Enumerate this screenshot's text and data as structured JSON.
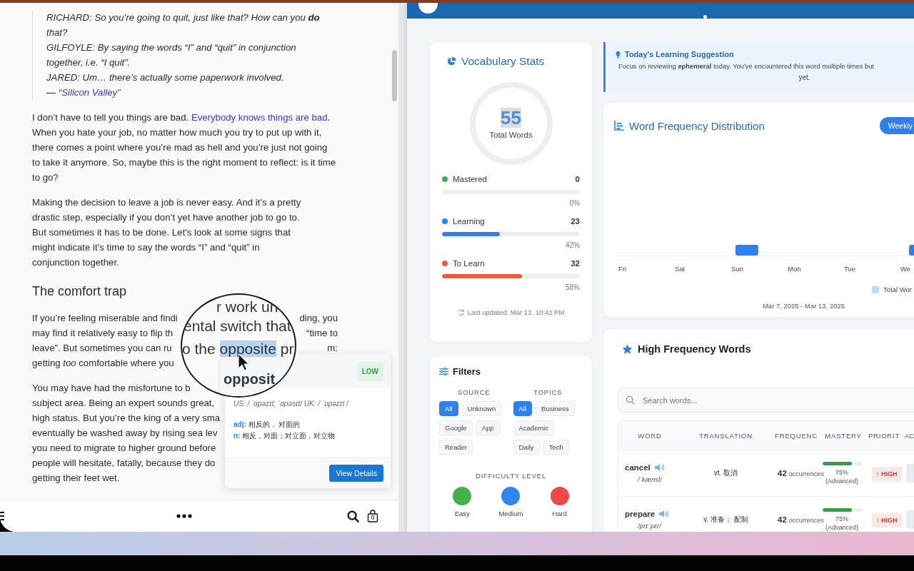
{
  "reader": {
    "quote_lines": [
      "RICHARD: So you’re going to quit, just like that? How can you **do** that?",
      "GILFOYLE: By saying the words “I” and “quit” in conjunction together, i.e. “I quit”.",
      "JARED: Um… there’s actually some paperwork involved."
    ],
    "quote_dash": "—",
    "quote_source": "“Silicon Valley”",
    "paragraph_1": {
      "before": "I don’t have to tell you things are bad. ",
      "link": "Everybody knows things are bad",
      "after": ". When you hate your job, no matter how much you try to put up with it, there comes a point where you’re mad as hell and you’re just not going to take it anymore. So, maybe this is the right moment to reflect: is it time to go?"
    },
    "paragraph_2": "Making the decision to leave a job is never easy. And it’s a pretty drastic step, especially if you don’t yet have another job to go to. But sometimes it has to be done. Let’s look at some signs that might indicate it’s time to say the words “I” and “quit” in conjunction together.",
    "heading": "The comfort trap",
    "cut_paragraphs": [
      {
        "lines": [
          {
            "left": "If you’re feeling miserable and findi",
            "right": "ding, you"
          },
          {
            "left": "may find it relatively easy to flip th",
            "right": "“time to"
          },
          {
            "left": "leave”. But sometimes you can ru",
            "right": "m:"
          },
          {
            "left": "getting *too* comfortable where you"
          }
        ]
      },
      {
        "lines": [
          {
            "left": "You may have had the misfortune to b"
          },
          {
            "left": "subject area. Being an expert sounds great,"
          },
          {
            "left": "high status. But you’re the king of a very sma"
          },
          {
            "left": "eventually be washed away by rising sea lev"
          },
          {
            "left": "you need to migrate to higher ground before"
          },
          {
            "left": "people will hesitate, fatally, because they do"
          },
          {
            "left": "getting their feet wet."
          }
        ]
      }
    ],
    "magnifier": {
      "lines": [
        "r work un",
        "ental switch that"
      ],
      "before": "o the ",
      "highlight": "opposite",
      "after": " pr",
      "word": "opposit"
    },
    "popup": {
      "badge": "LOW",
      "pronunciation": "US: / ˈɑpəzɪt; ˈɑpəsɪt/   UK: / ˈɒpəzɪt /",
      "definitions": [
        {
          "pos": "adj:",
          "text": "相反的， 对面的"
        },
        {
          "pos": "n:",
          "text": "相反，对面；对立面，对立物"
        }
      ],
      "button": "View Details"
    },
    "toolbar": {
      "bag_count": "0"
    }
  },
  "dashboard": {
    "vocab_stats": {
      "title": "Vocabulary Stats",
      "total": "55",
      "total_label": "Total Words",
      "rows": [
        {
          "label": "Mastered",
          "count": "0",
          "level": 0,
          "percent": "0%",
          "color": "#3cb05a"
        },
        {
          "label": "Learning",
          "count": "23",
          "level": 0.42,
          "percent": "42%",
          "color": "#2f80ed"
        },
        {
          "label": "To Learn",
          "count": "32",
          "level": 0.58,
          "percent": "58%",
          "color": "#f05a3a"
        }
      ],
      "updated": "Last updated: Mar 13, 10:42 PM"
    },
    "suggestion": {
      "title": "Today's Learning Suggestion",
      "line_1": "Focus on reviewing **ephemeral** today. You've encountered this word multiple times but",
      "line_2": "yet."
    },
    "frequency": {
      "title": "Word Frequency Distribution",
      "button": "Weekly",
      "days": [
        "Fri",
        "Sat",
        "Sun",
        "Mon",
        "Tue",
        "We"
      ],
      "legend": "Total Wor",
      "range": "Mar 7, 2025 - Mar 13, 2025"
    },
    "filters": {
      "title": "Filters",
      "groups": [
        {
          "label": "SOURCE",
          "chips": [
            {
              "label": "All",
              "selected": true
            },
            {
              "label": "Unknown",
              "selected": false
            },
            {
              "label": "Google",
              "selected": false
            },
            {
              "label": "App",
              "selected": false
            },
            {
              "label": "Reader",
              "selected": false
            }
          ]
        },
        {
          "label": "TOPICS",
          "chips": [
            {
              "label": "All",
              "selected": true
            },
            {
              "label": "Business",
              "selected": false
            },
            {
              "label": "Academic",
              "selected": false
            },
            {
              "label": "Daily",
              "selected": false
            },
            {
              "label": "Tech",
              "selected": false
            }
          ]
        }
      ],
      "difficulty_label": "DIFFICULTY LEVEL",
      "levels": [
        {
          "label": "Easy",
          "color": "#43b049"
        },
        {
          "label": "Medium",
          "color": "#2f86f0"
        },
        {
          "label": "Hard",
          "color": "#f04848"
        }
      ]
    },
    "words": {
      "title": "High Frequency Words",
      "search_placeholder": "Search words...",
      "columns": [
        "WORD",
        "TRANSLATION",
        "FREQUENC",
        "MASTERY",
        "PRIORIT",
        "AC"
      ],
      "rows": [
        {
          "word": "cancel",
          "phonetic": "/ˈkænsl/",
          "translation": "vt. 取消",
          "count": "42",
          "count_label": "occurrences",
          "level": 0.75,
          "mastery": "75%",
          "mastery_label": "(Advanced)",
          "priority": "↑ HIGH"
        },
        {
          "word": "prepare",
          "phonetic": "/prɪˈpɛr/",
          "translation": "v. 准备； 配制",
          "count": "42",
          "count_label": "occurrences",
          "level": 0.75,
          "mastery": "75%",
          "mastery_label": "(Advanced)",
          "priority": "↑ HIGH"
        }
      ]
    }
  }
}
